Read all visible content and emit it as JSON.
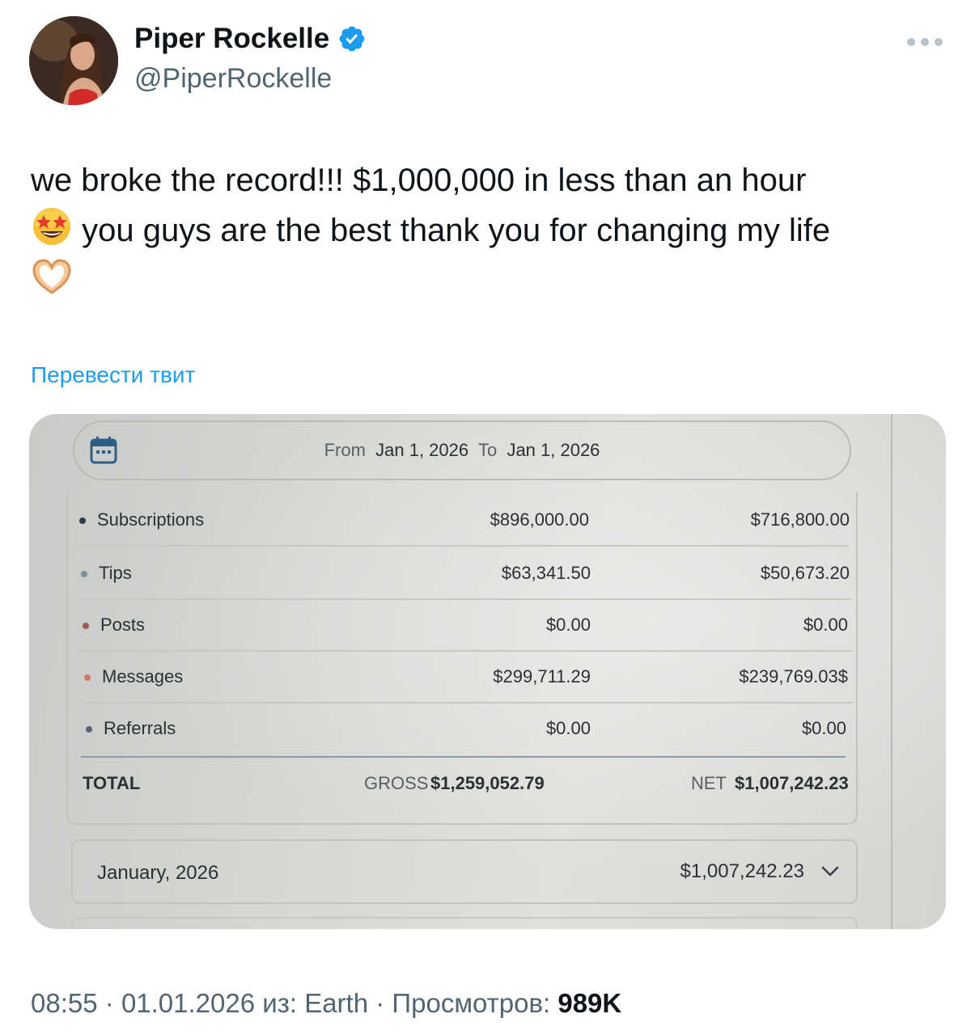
{
  "author": {
    "display_name": "Piper Rockelle",
    "handle": "@PiperRockelle",
    "verified": true
  },
  "tweet": {
    "line1": "we broke the record!!! $1,000,000 in less than an hour",
    "line2": "you guys are the best thank you for changing my life",
    "emoji1": "star-struck-emoji",
    "emoji2": "heart-hands-emoji",
    "translate_label": "Перевести твит"
  },
  "photo": {
    "date_range": {
      "from_label": "From",
      "from_date": "Jan 1, 2026",
      "to_label": "To",
      "to_date": "Jan 1, 2026"
    },
    "rows": [
      {
        "label": "Subscriptions",
        "gross": "$896,000.00",
        "net": "$716,800.00",
        "bullet_color": "#2e3a4a"
      },
      {
        "label": "Tips",
        "gross": "$63,341.50",
        "net": "$50,673.20",
        "bullet_color": "#7f8f9c"
      },
      {
        "label": "Posts",
        "gross": "$0.00",
        "net": "$0.00",
        "bullet_color": "#a05a5a"
      },
      {
        "label": "Messages",
        "gross": "$299,711.29",
        "net": "$239,769.03$",
        "bullet_color": "#c97a6a"
      },
      {
        "label": "Referrals",
        "gross": "$0.00",
        "net": "$0.00",
        "bullet_color": "#5b6470"
      }
    ],
    "total": {
      "label": "TOTAL",
      "gross_label": "GROSS",
      "gross_value": "$1,259,052.79",
      "net_label": "NET",
      "net_value": "$1,007,242.23"
    },
    "month": {
      "label": "January, 2026",
      "amount": "$1,007,242.23"
    }
  },
  "meta": {
    "time": "08:55",
    "date": "01.01.2026",
    "source_prefix": "из:",
    "source": "Earth",
    "views_label": "Просмотров:",
    "views": "989K"
  },
  "colors": {
    "link": "#1d9bf0",
    "verified": "#1d9bf0",
    "muted": "#536471"
  }
}
